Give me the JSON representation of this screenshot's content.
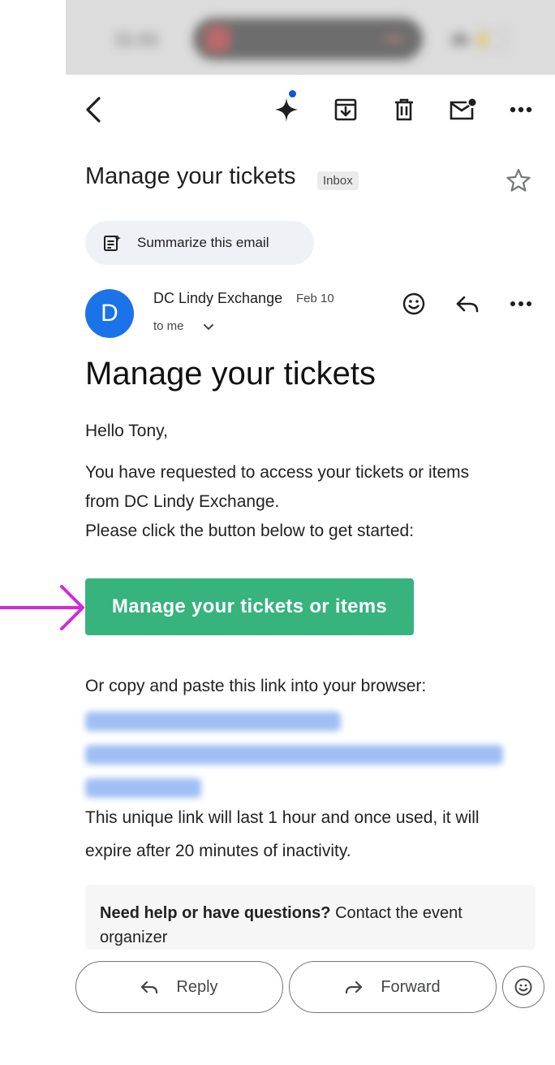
{
  "status_bar": {
    "time": "11:01"
  },
  "toolbar": {
    "back": "back-icon",
    "gemini": "sparkle-icon",
    "archive": "archive-icon",
    "delete": "trash-icon",
    "mark_unread": "mail-unread-icon",
    "more": "more-horizontal-icon"
  },
  "subject": {
    "title": "Manage your tickets",
    "label": "Inbox"
  },
  "summarize": {
    "label": "Summarize this email"
  },
  "message": {
    "avatar_letter": "D",
    "sender": "DC Lindy Exchange",
    "date": "Feb 10",
    "recipient": "to me"
  },
  "body": {
    "heading": "Manage your tickets",
    "greeting": "Hello Tony,",
    "line1": "You have requested to access your tickets or items",
    "line2": "from DC Lindy Exchange.",
    "line3": "Please click the button below to get started:",
    "cta_label": "Manage your tickets or items",
    "copy_text": "Or copy and paste this link into your browser:",
    "expiry_line1": "This unique link will last 1 hour and once used, it will",
    "expiry_line2": "expire after 20 minutes of inactivity.",
    "help_bold": "Need help or have questions?",
    "help_rest": " Contact the event",
    "help_line2": "organizer"
  },
  "actions": {
    "reply": "Reply",
    "forward": "Forward"
  },
  "colors": {
    "cta": "#37b37e",
    "accent": "#1a73e8",
    "annotation_arrow": "#d12ad9"
  }
}
